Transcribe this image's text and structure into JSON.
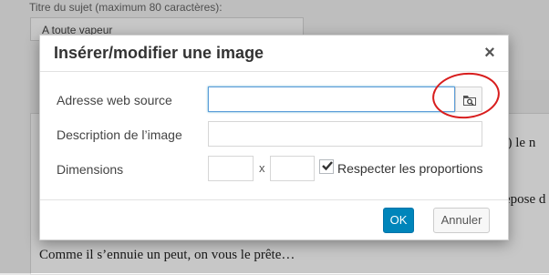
{
  "background": {
    "subject_label": "Titre du sujet (maximum 80 caractères):",
    "subject_value": "A toute vapeur",
    "text_line_1": ", …) le n",
    "text_line_2": "repose d",
    "text_line_3": "Comme il s’ennuie un peut, on vous le prête…"
  },
  "dialog": {
    "title": "Insérer/modifier une image",
    "close_glyph": "×",
    "source_label": "Adresse web source",
    "source_value": "",
    "description_label": "Description de l’image",
    "description_value": "",
    "dimensions_label": "Dimensions",
    "width_value": "",
    "height_value": "",
    "times_glyph": "x",
    "constrain_label": "Respecter les proportions",
    "constrain_checked": true,
    "ok_label": "OK",
    "cancel_label": "Annuler"
  },
  "colors": {
    "accent": "#0085ba",
    "annotation": "#d81e1e",
    "focus": "#5b9dd9"
  },
  "icons": {
    "browse": "browse-folder-icon",
    "close": "close-icon",
    "check": "checkmark-icon"
  }
}
